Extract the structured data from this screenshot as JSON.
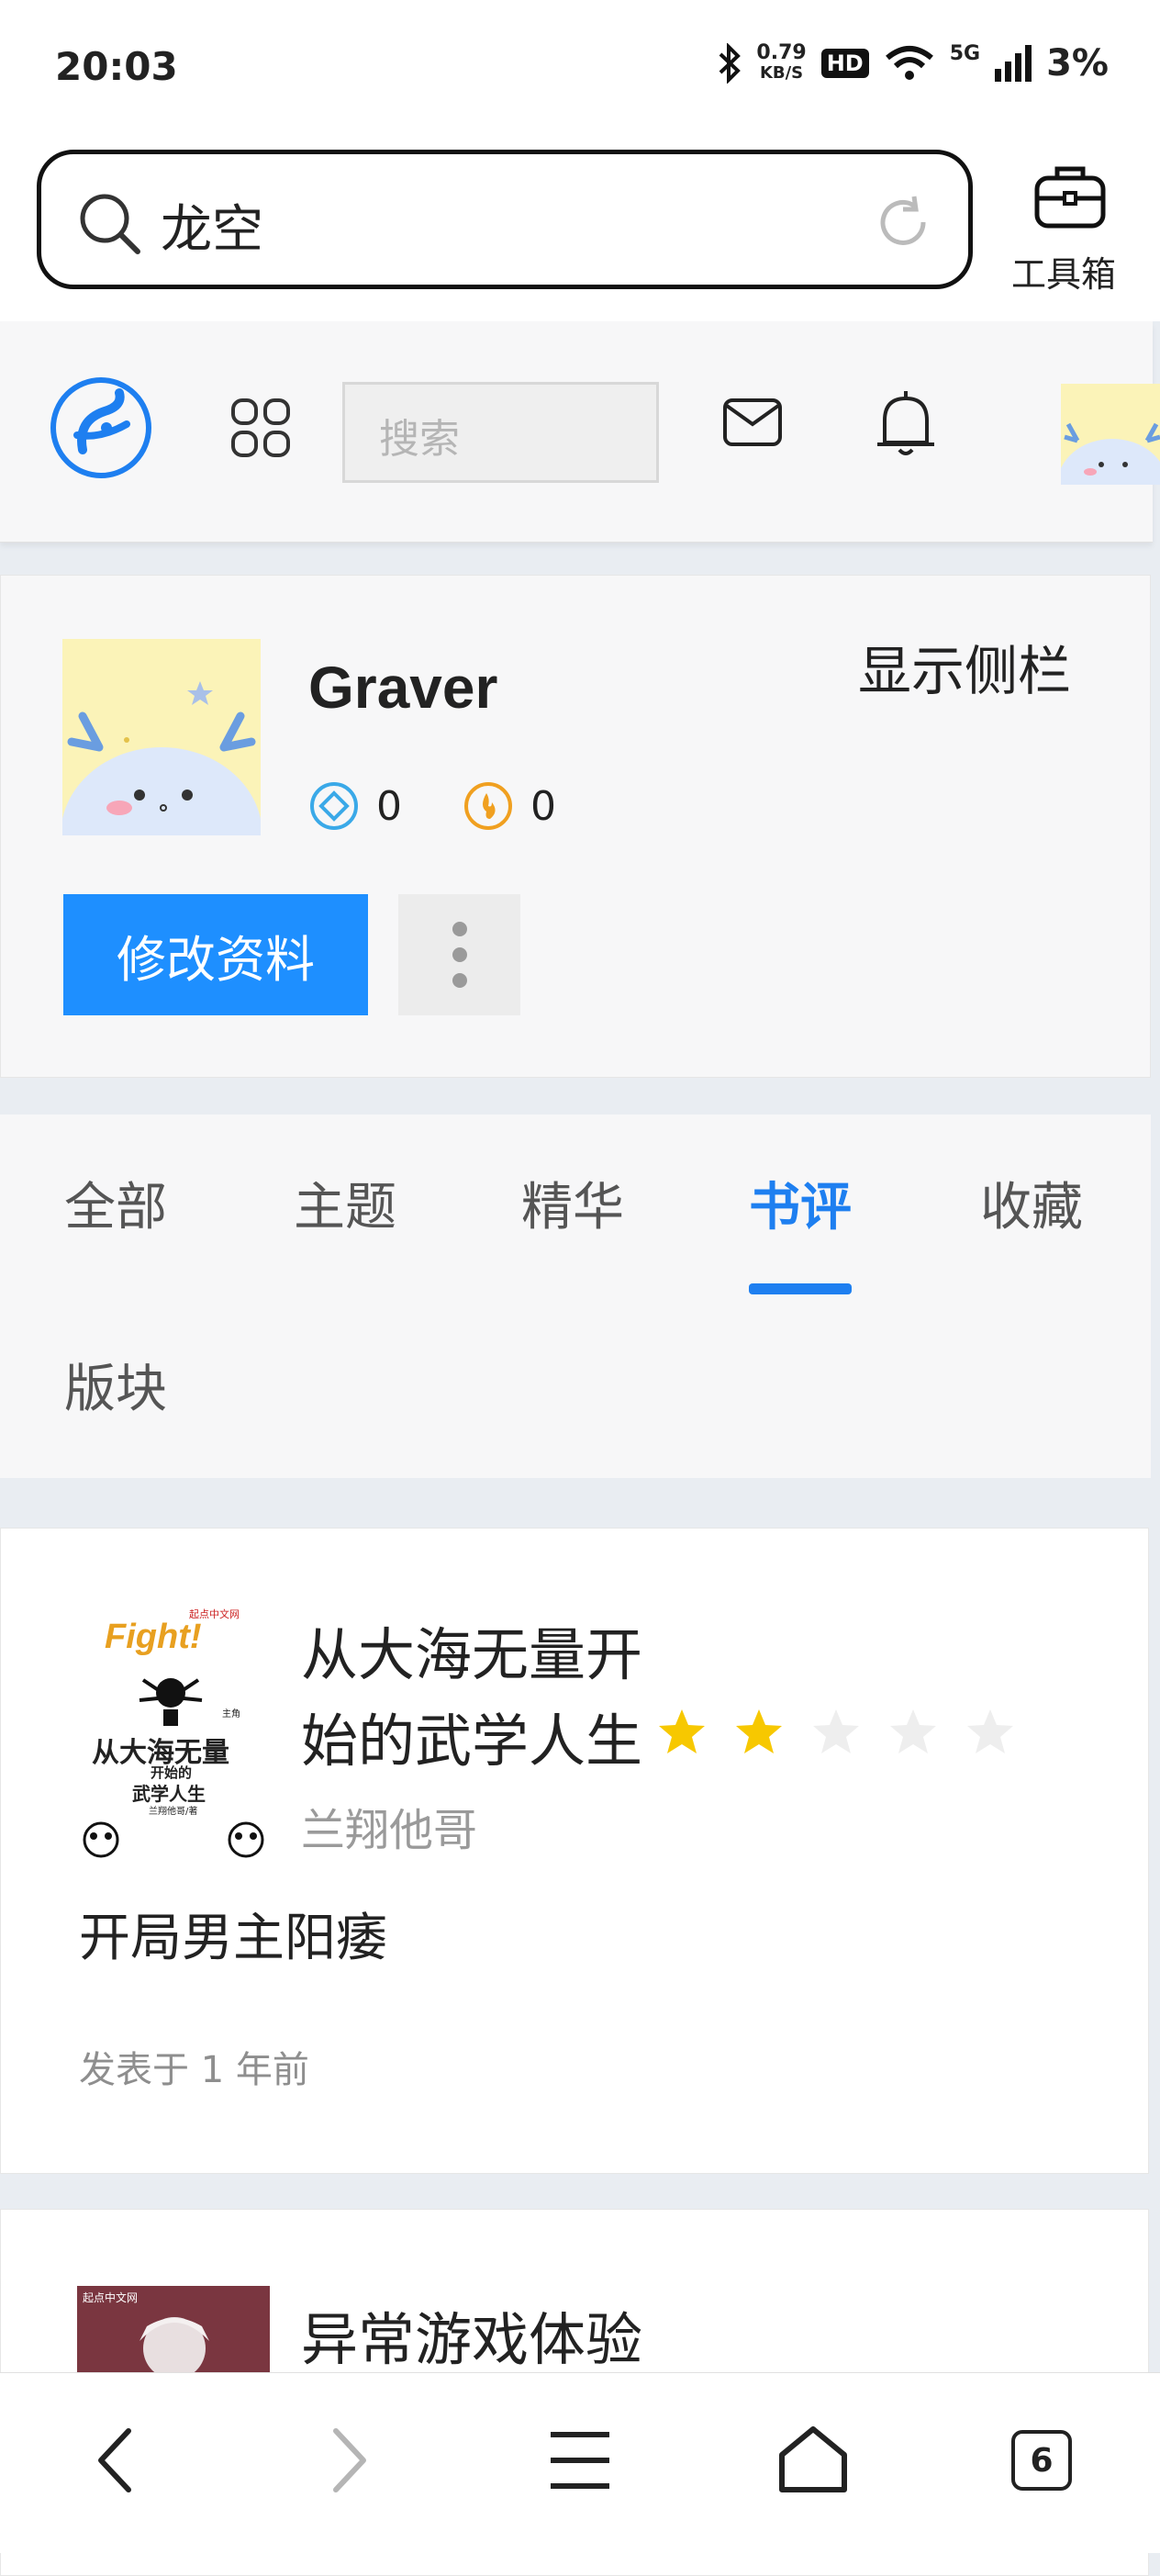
{
  "status_bar": {
    "time": "20:03",
    "net_speed_value": "0.79",
    "net_speed_unit": "KB/S",
    "hd_badge": "HD",
    "network": "5G",
    "battery": "3%"
  },
  "browser": {
    "address_text": "龙空",
    "toolbox_label": "工具箱",
    "tab_count": "6"
  },
  "site_header": {
    "search_placeholder": "搜索"
  },
  "profile": {
    "username": "Graver",
    "toggle_sidebar_label": "显示侧栏",
    "stat_1_value": "0",
    "stat_2_value": "0",
    "edit_button_label": "修改资料"
  },
  "tabs": {
    "items": [
      "全部",
      "主题",
      "精华",
      "书评",
      "收藏",
      "版块"
    ],
    "active": "书评"
  },
  "reviews": [
    {
      "book_title": "从大海无量开始的武学人生",
      "title_line1": "从大海无量开",
      "title_line2": "始的武学人生",
      "rating": 2,
      "rating_max": 5,
      "author": "兰翔他哥",
      "text": "开局男主阳痿",
      "posted": "发表于 1 年前",
      "cover_text": {
        "brand": "起点中文网",
        "fight": "Fight!",
        "title_big": "从大海无量",
        "title_small": "开始的",
        "title_small2": "武学人生",
        "author_line": "兰翔他哥/著",
        "protagonist": "主角"
      }
    },
    {
      "book_title": "异常游戏体验",
      "cover_text": {
        "brand": "起点中文网"
      }
    }
  ],
  "colors": {
    "accent": "#1e7ff0",
    "button_blue": "#1e8fff",
    "star_active": "#f7c800",
    "star_inactive": "#eeeeee"
  }
}
